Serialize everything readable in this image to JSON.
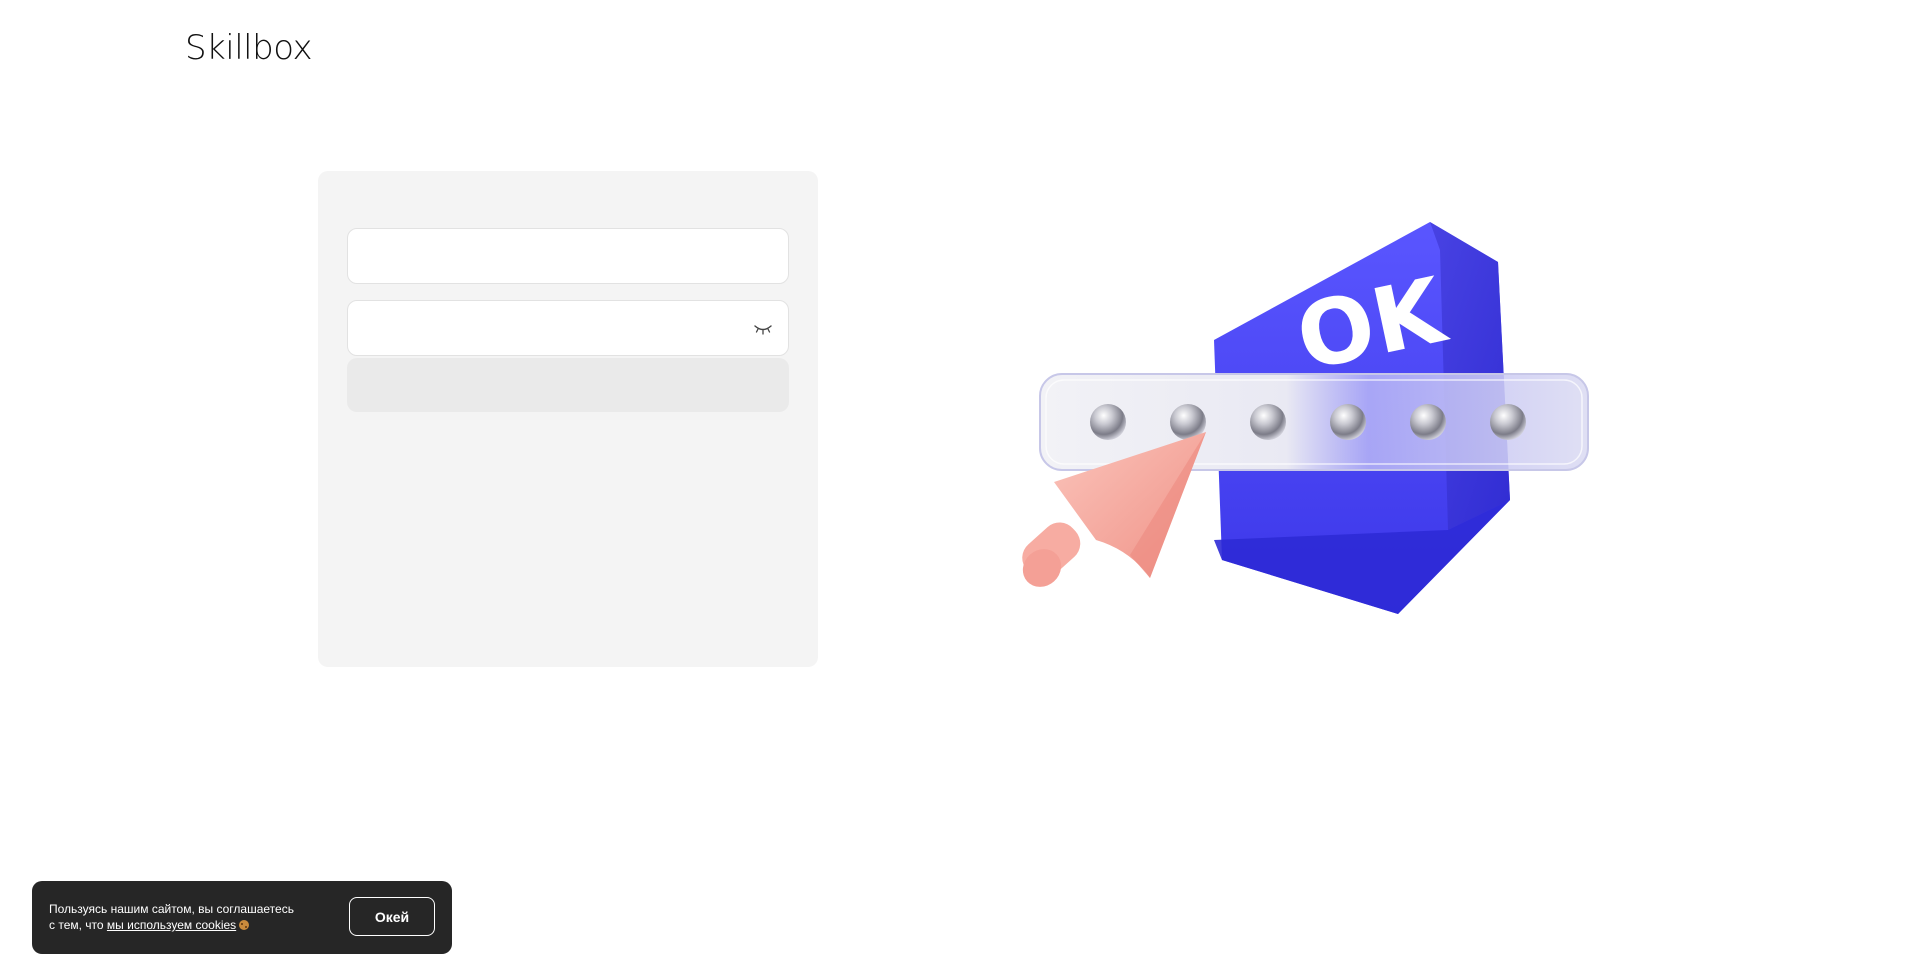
{
  "header": {
    "logo_text": "Skillbox"
  },
  "login_form": {
    "login_value": "",
    "password_value": "",
    "submit_label": "",
    "password_toggle_icon": "eye-closed-icon"
  },
  "illustration": {
    "badge_text": "OK",
    "password_dot_count_text": "••••••",
    "colors": {
      "badge_blue": "#4a4af0",
      "cursor_pink": "#f3a79f",
      "field_glass": "#e8e8f4"
    }
  },
  "cookie_banner": {
    "text_line_1": "Пользуясь нашим сайтом, вы соглашаетесь",
    "text_line_2_prefix": "с тем, что ",
    "link_text": "мы используем cookies",
    "ok_button_label": "Окей",
    "colors": {
      "background": "#262626",
      "text": "#ffffff"
    }
  }
}
